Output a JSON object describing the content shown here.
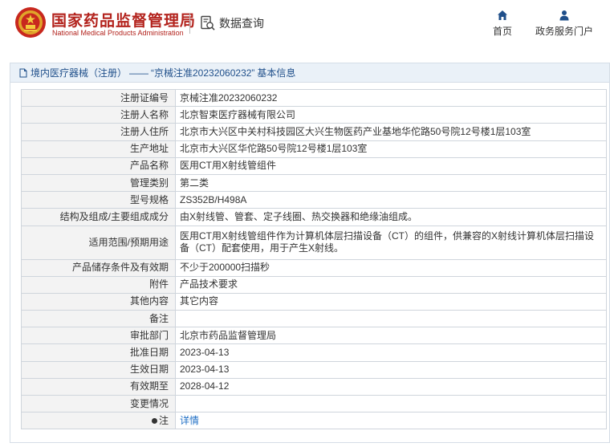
{
  "header": {
    "org_cn": "国家药品监督管理局",
    "org_en": "National Medical Products Administration",
    "query_label": "数据查询",
    "nav": {
      "home": "首页",
      "service": "政务服务门户"
    },
    "colors": {
      "brand_red": "#b3231d",
      "nav_blue": "#1f4f8a"
    },
    "icons": [
      "emblem-logo",
      "data-search-icon",
      "home-icon",
      "user-icon"
    ]
  },
  "panel": {
    "breadcrumb": {
      "category": "境内医疗器械（注册）",
      "separator": "——",
      "record": "“京械注准20232060232”",
      "suffix": "基本信息"
    },
    "rows": [
      {
        "label": "注册证编号",
        "value": "京械注准20232060232"
      },
      {
        "label": "注册人名称",
        "value": "北京智束医疗器械有限公司"
      },
      {
        "label": "注册人住所",
        "value": "北京市大兴区中关村科技园区大兴生物医药产业基地华佗路50号院12号楼1层103室"
      },
      {
        "label": "生产地址",
        "value": "北京市大兴区华佗路50号院12号楼1层103室"
      },
      {
        "label": "产品名称",
        "value": "医用CT用X射线管组件"
      },
      {
        "label": "管理类别",
        "value": "第二类"
      },
      {
        "label": "型号规格",
        "value": "ZS352B/H498A"
      },
      {
        "label": "结构及组成/主要组成成分",
        "value": "由X射线管、管套、定子线圈、热交换器和绝缘油组成。"
      },
      {
        "label": "适用范围/预期用途",
        "value": "医用CT用X射线管组件作为计算机体层扫描设备（CT）的组件，供兼容的X射线计算机体层扫描设备（CT）配套使用，用于产生X射线。"
      },
      {
        "label": "产品储存条件及有效期",
        "value": "不少于200000扫描秒"
      },
      {
        "label": "附件",
        "value": "产品技术要求"
      },
      {
        "label": "其他内容",
        "value": "其它内容"
      },
      {
        "label": "备注",
        "value": ""
      },
      {
        "label": "审批部门",
        "value": "北京市药品监督管理局"
      },
      {
        "label": "批准日期",
        "value": "2023-04-13"
      },
      {
        "label": "生效日期",
        "value": "2023-04-13"
      },
      {
        "label": "有效期至",
        "value": "2028-04-12"
      },
      {
        "label": "变更情况",
        "value": ""
      }
    ],
    "note_row": {
      "label": "注",
      "link_text": "详情"
    }
  }
}
